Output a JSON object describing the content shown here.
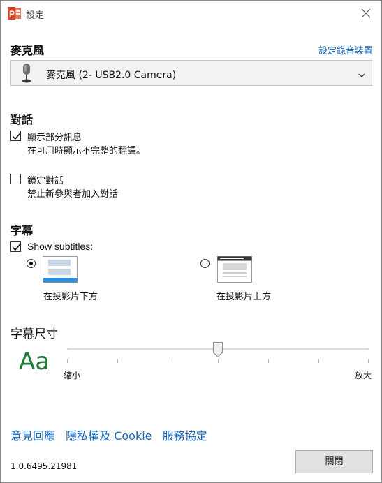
{
  "window": {
    "title": "設定"
  },
  "microphone": {
    "section_title": "麥克風",
    "setup_link": "設定錄音裝置",
    "selected_device": "麥克風 (2- USB2.0 Camera)"
  },
  "conversation": {
    "section_title": "對話",
    "show_partial": {
      "label": "顯示部分訊息",
      "description": "在可用時顯示不完整的翻譯。",
      "checked": true
    },
    "lock_conversation": {
      "label": "鎖定對話",
      "description": "禁止新參與者加入對話",
      "checked": false
    }
  },
  "subtitles": {
    "section_title": "字幕",
    "show_subtitles": {
      "label": "Show subtitles:",
      "checked": true
    },
    "position_options": [
      {
        "label": "在投影片下方",
        "selected": true
      },
      {
        "label": "在投影片上方",
        "selected": false
      }
    ]
  },
  "subtitle_size": {
    "section_title": "字幕尺寸",
    "sample_text": "Aa",
    "min_label": "縮小",
    "max_label": "放大",
    "level_fraction": 0.5
  },
  "footer": {
    "links": [
      "意見回應",
      "隱私權及 Cookie",
      "服務協定"
    ],
    "version": "1.0.6495.21981",
    "close_button": "關閉"
  },
  "colors": {
    "link": "#1565b8",
    "sample_text": "#1f7a3a",
    "accent_icon": "#d24726"
  }
}
